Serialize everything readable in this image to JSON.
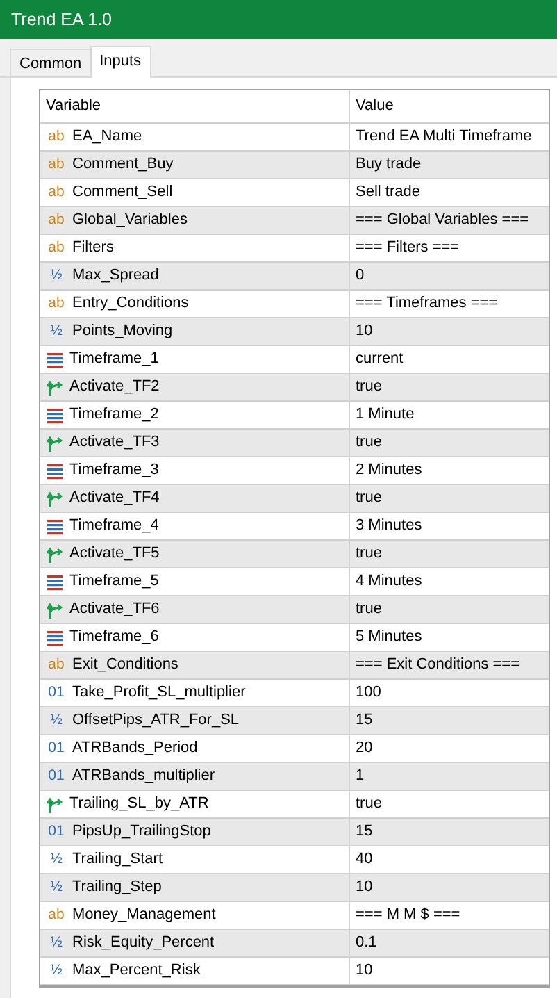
{
  "window": {
    "title": "Trend EA 1.0"
  },
  "tabs": [
    {
      "label": "Common",
      "selected": false
    },
    {
      "label": "Inputs",
      "selected": true
    }
  ],
  "table": {
    "columns": [
      "Variable",
      "Value"
    ],
    "rows": [
      {
        "kind": "string",
        "type_icon": "ab",
        "variable": "EA_Name",
        "value": "Trend EA Multi Timeframe"
      },
      {
        "kind": "string",
        "type_icon": "ab",
        "variable": "Comment_Buy",
        "value": "Buy trade"
      },
      {
        "kind": "string",
        "type_icon": "ab",
        "variable": "Comment_Sell",
        "value": "Sell trade"
      },
      {
        "kind": "string",
        "type_icon": "ab",
        "variable": "Global_Variables",
        "value": "=== Global Variables ==="
      },
      {
        "kind": "string",
        "type_icon": "ab",
        "variable": "Filters",
        "value": "=== Filters ==="
      },
      {
        "kind": "double",
        "type_icon": "½",
        "variable": "Max_Spread",
        "value": "0"
      },
      {
        "kind": "string",
        "type_icon": "ab",
        "variable": "Entry_Conditions",
        "value": "=== Timeframes ==="
      },
      {
        "kind": "double",
        "type_icon": "½",
        "variable": "Points_Moving",
        "value": "10"
      },
      {
        "kind": "enum",
        "variable": "Timeframe_1",
        "value": "current"
      },
      {
        "kind": "bool",
        "variable": "Activate_TF2",
        "value": "true"
      },
      {
        "kind": "enum",
        "variable": "Timeframe_2",
        "value": "1 Minute"
      },
      {
        "kind": "bool",
        "variable": "Activate_TF3",
        "value": "true"
      },
      {
        "kind": "enum",
        "variable": "Timeframe_3",
        "value": "2 Minutes"
      },
      {
        "kind": "bool",
        "variable": "Activate_TF4",
        "value": "true"
      },
      {
        "kind": "enum",
        "variable": "Timeframe_4",
        "value": "3 Minutes"
      },
      {
        "kind": "bool",
        "variable": "Activate_TF5",
        "value": "true"
      },
      {
        "kind": "enum",
        "variable": "Timeframe_5",
        "value": "4 Minutes"
      },
      {
        "kind": "bool",
        "variable": "Activate_TF6",
        "value": "true"
      },
      {
        "kind": "enum",
        "variable": "Timeframe_6",
        "value": "5 Minutes"
      },
      {
        "kind": "string",
        "type_icon": "ab",
        "variable": "Exit_Conditions",
        "value": "=== Exit Conditions ==="
      },
      {
        "kind": "int",
        "type_icon": "01",
        "variable": "Take_Profit_SL_multiplier",
        "value": "100"
      },
      {
        "kind": "double",
        "type_icon": "½",
        "variable": "OffsetPips_ATR_For_SL",
        "value": "15"
      },
      {
        "kind": "int",
        "type_icon": "01",
        "variable": "ATRBands_Period",
        "value": "20"
      },
      {
        "kind": "int",
        "type_icon": "01",
        "variable": "ATRBands_multiplier",
        "value": "1"
      },
      {
        "kind": "bool",
        "variable": "Trailing_SL_by_ATR",
        "value": "true"
      },
      {
        "kind": "int",
        "type_icon": "01",
        "variable": "PipsUp_TrailingStop",
        "value": "15"
      },
      {
        "kind": "double",
        "type_icon": "½",
        "variable": "Trailing_Start",
        "value": "40"
      },
      {
        "kind": "double",
        "type_icon": "½",
        "variable": "Trailing_Step",
        "value": "10"
      },
      {
        "kind": "string",
        "type_icon": "ab",
        "variable": "Money_Management",
        "value": "=== M M $ ==="
      },
      {
        "kind": "double",
        "type_icon": "½",
        "variable": "Risk_Equity_Percent",
        "value": "0.1"
      },
      {
        "kind": "double",
        "type_icon": "½",
        "variable": "Max_Percent_Risk",
        "value": "10"
      }
    ]
  }
}
